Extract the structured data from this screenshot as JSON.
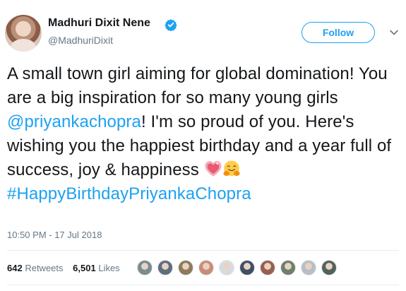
{
  "author": {
    "name": "Madhuri Dixit Nene",
    "handle": "@MadhuriDixit",
    "avatar_icon": "user-avatar",
    "verified_icon": "verified-badge-icon"
  },
  "follow_label": "Follow",
  "tweet": {
    "text_part1": "A small town girl aiming for global domination! You are a big inspiration for so many young girls ",
    "mention": "@priyankachopra",
    "text_part2": "! I'm so proud of you. Here's wishing you the happiest birthday and a year full of success, joy & happiness ",
    "emojis": [
      "sparkling-heart-emoji",
      "hugging-face-emoji"
    ],
    "hashtag": "#HappyBirthdayPriyankaChopra"
  },
  "timestamp": "10:50 PM - 17 Jul 2018",
  "stats": {
    "retweets_count": "642",
    "retweets_label": "Retweets",
    "likes_count": "6,501",
    "likes_label": "Likes"
  },
  "liker_avatar_colors": [
    "#7a8c8f",
    "#5f6d7e",
    "#8e7b5a",
    "#c98d76",
    "#d7dbe0",
    "#3f4f64",
    "#9b5f4e",
    "#6e7f6a",
    "#b6bec6",
    "#52635a"
  ],
  "colors": {
    "accent": "#1da1f2",
    "text": "#14171a",
    "muted": "#657786"
  }
}
